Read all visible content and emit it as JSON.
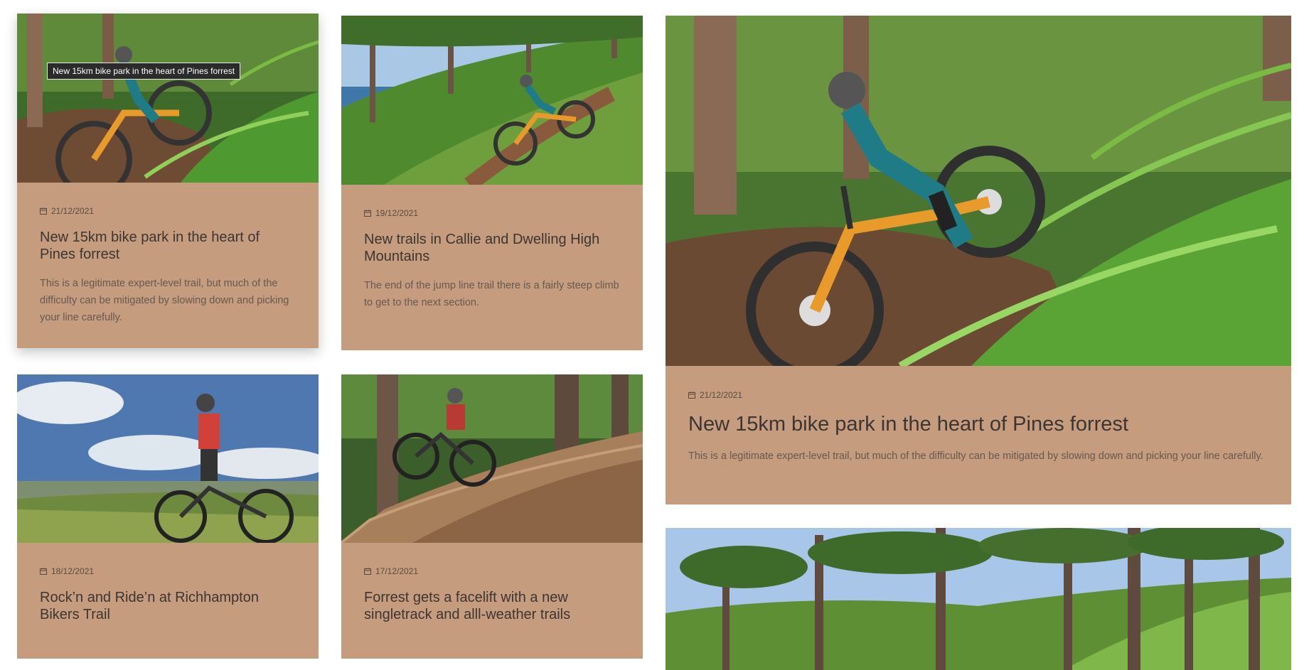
{
  "posts": [
    {
      "date": "21/12/2021",
      "title": "New 15km bike park in the heart of Pines forrest",
      "excerpt": "This is a legitimate expert-level trail, but much of the difficulty can be mitigated by slowing down and picking your line carefully."
    },
    {
      "date": "19/12/2021",
      "title": "New trails in Callie and Dwelling High Mountains",
      "excerpt": "The end of the jump line trail there is a fairly steep climb to get to the next section."
    },
    {
      "date": "21/12/2021",
      "title": "New 15km bike park in the heart of Pines forrest",
      "excerpt": "This is a legitimate expert-level trail, but much of the difficulty can be mitigated by slowing down and picking your line carefully."
    },
    {
      "date": "18/12/2021",
      "title": "Rock’n and Ride’n at Richhampton Bikers Trail",
      "excerpt": ""
    },
    {
      "date": "17/12/2021",
      "title": "Forrest gets a facelift with a new singletrack and alll-weather trails",
      "excerpt": ""
    }
  ],
  "tooltip": "New 15km bike park in the heart of Pines forrest",
  "colors": {
    "card_background": "#c59c7e",
    "title_text": "#3d3531",
    "body_text": "#675850"
  }
}
